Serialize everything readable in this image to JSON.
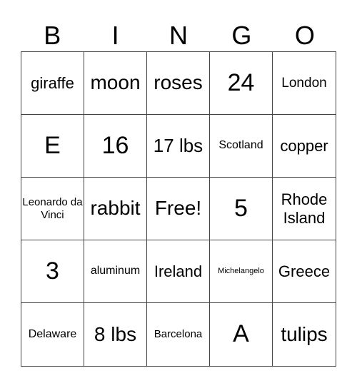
{
  "header": [
    "B",
    "I",
    "N",
    "G",
    "O"
  ],
  "cells": [
    {
      "text": "giraffe",
      "size": "s-m"
    },
    {
      "text": "moon",
      "size": "s-l"
    },
    {
      "text": "roses",
      "size": "s-l"
    },
    {
      "text": "24",
      "size": "s-xl"
    },
    {
      "text": "London",
      "size": "s-s"
    },
    {
      "text": "E",
      "size": "s-xl"
    },
    {
      "text": "16",
      "size": "s-xl"
    },
    {
      "text": "17 lbs",
      "size": "s-ml"
    },
    {
      "text": "Scotland",
      "size": "s-xs"
    },
    {
      "text": "copper",
      "size": "s-m"
    },
    {
      "text": "Leonardo da Vinci",
      "size": "s-xxs"
    },
    {
      "text": "rabbit",
      "size": "s-l"
    },
    {
      "text": "Free!",
      "size": "s-l"
    },
    {
      "text": "5",
      "size": "s-xl"
    },
    {
      "text": "Rhode Island",
      "size": "s-m"
    },
    {
      "text": "3",
      "size": "s-xl"
    },
    {
      "text": "aluminum",
      "size": "s-xs"
    },
    {
      "text": "Ireland",
      "size": "s-m"
    },
    {
      "text": "Michelangelo",
      "size": "s-tiny"
    },
    {
      "text": "Greece",
      "size": "s-m"
    },
    {
      "text": "Delaware",
      "size": "s-xs"
    },
    {
      "text": "8 lbs",
      "size": "s-l"
    },
    {
      "text": "Barcelona",
      "size": "s-xxs"
    },
    {
      "text": "A",
      "size": "s-xl"
    },
    {
      "text": "tulips",
      "size": "s-l"
    }
  ]
}
